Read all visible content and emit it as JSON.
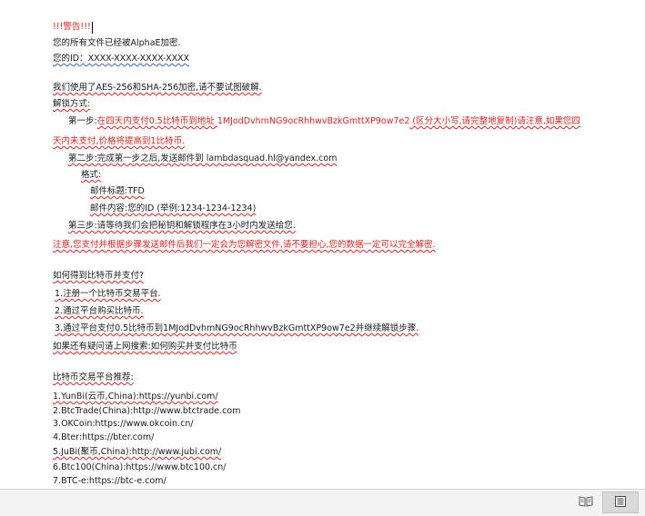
{
  "document": {
    "title": "!!!警告!!!",
    "intro": [
      "您的所有文件已经被AlphaE加密.",
      "您的ID：XXXX-XXXX-XXXX-XXXX"
    ],
    "enc_line": "我们使用了AES-256和SHA-256加密,请不要试图破解.",
    "unlock_heading": "解锁方式:",
    "step1": {
      "prefix": "第一步:",
      "part_a": "在四天内支付0.5比特币到地址 ",
      "address": "1MJodDvhmNG9ocRhhwvBzkGmttXP9ow7e2",
      "part_b": " (区分大小写,请完整地复制)",
      "part_c": "请注意,如果您四",
      "line2": "天内未支付,价格将提高到1比特币."
    },
    "step2": "第二步:完成第一步之后,发送邮件到 lambdasquad.hl@yandex.com",
    "format_label": "格式:",
    "mail_subject": "邮件标题:TFD",
    "mail_body": "邮件内容:您的ID (举例:1234-1234-1234)",
    "step3": "第三步:请等待我们会把秘钥和解锁程序在3小时内发送给您.",
    "note": "注意,您支付并根据步骤发送邮件后我们一定会为您解密文件,请不要担心,您的数据一定可以完全解密.",
    "howto_heading": "如何得到比特币并支付?",
    "howto_items": [
      "1.注册一个比特币交易平台.",
      "2.通过平台购买比特币.",
      "3.通过平台支付0.5比特币到1MJodDvhmNG9ocRhhwvBzkGmttXP9ow7e2并继续解锁步骤."
    ],
    "search_tip": "如果还有疑问请上网搜索:如何购买并支付比特币",
    "platforms_heading": "比特币交易平台推荐:",
    "platforms": [
      "1.YunBi(云币,China):https://yunbi.com/",
      "2.BtcTrade(China):http://www.btctrade.com",
      "3.OKCoin:https://www.okcoin.cn/",
      "4.Bter:https://bter.com/",
      "5.JuBi(聚币,China):http://www.jubi.com/",
      "6.Btc100(China):https://www.btc100.cn/",
      "7.BTC-e:https://btc-e.com/"
    ]
  },
  "statusbar": {
    "read_mode_icon": "book-icon",
    "print_layout_icon": "page-layout-icon"
  },
  "colors": {
    "warning": "#e0241f",
    "spellcheck": "#e0241f",
    "grammar": "#3a5fd9"
  }
}
